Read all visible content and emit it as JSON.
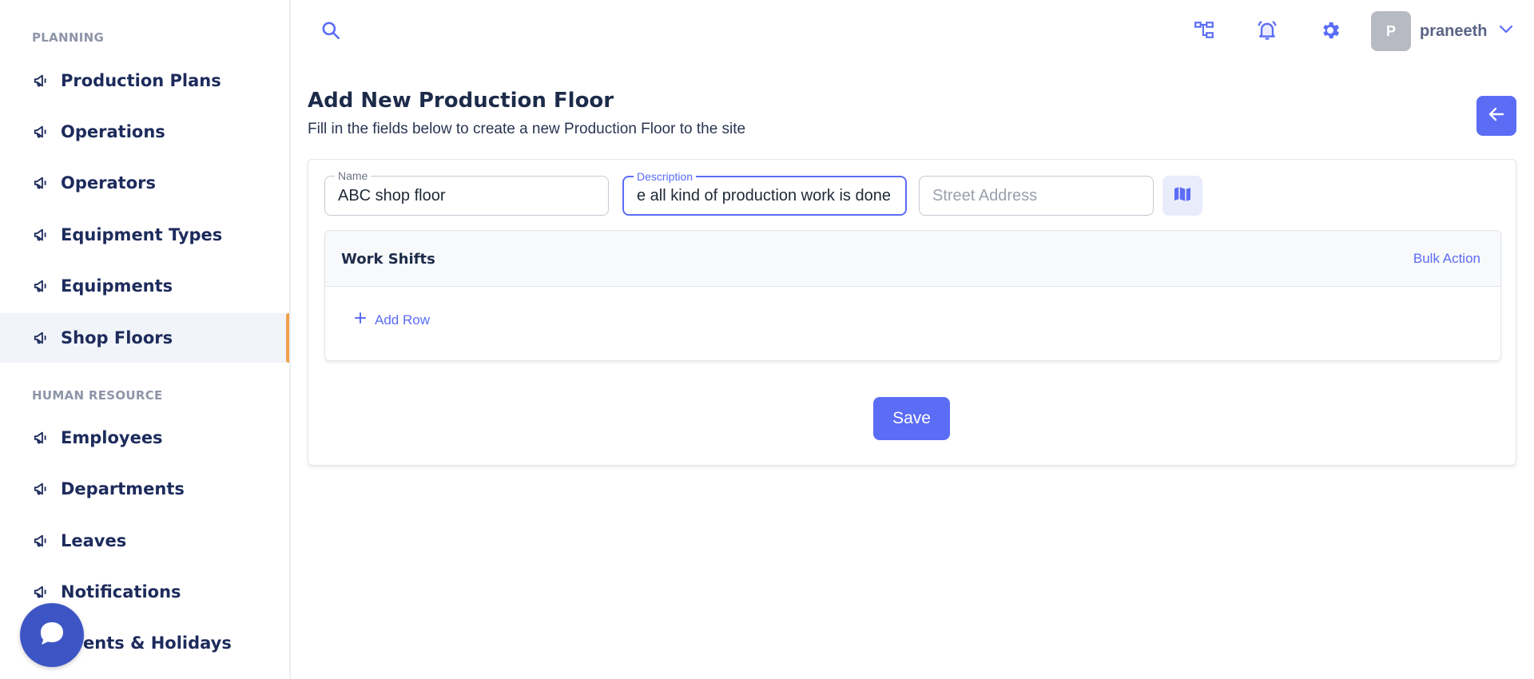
{
  "sidebar": {
    "sections": [
      {
        "label": "PLANNING",
        "items": [
          {
            "label": "Production Plans",
            "icon": "megaphone-icon"
          },
          {
            "label": "Operations",
            "icon": "megaphone-icon"
          },
          {
            "label": "Operators",
            "icon": "megaphone-icon"
          },
          {
            "label": "Equipment Types",
            "icon": "megaphone-icon"
          },
          {
            "label": "Equipments",
            "icon": "megaphone-icon"
          },
          {
            "label": "Shop Floors",
            "icon": "megaphone-icon",
            "active": true
          }
        ]
      },
      {
        "label": "HUMAN RESOURCE",
        "items": [
          {
            "label": "Employees",
            "icon": "megaphone-icon"
          },
          {
            "label": "Departments",
            "icon": "megaphone-icon"
          },
          {
            "label": "Leaves",
            "icon": "megaphone-icon"
          },
          {
            "label": "Notifications",
            "icon": "megaphone-icon"
          },
          {
            "label": "Events & Holidays",
            "icon": "megaphone-icon"
          }
        ]
      }
    ],
    "active_accent_color": "#f0a04b"
  },
  "header": {
    "icons": [
      "search-icon",
      "sitemap-icon",
      "bell-icon",
      "gear-icon",
      "chevron-down-icon"
    ],
    "user": {
      "avatar_initial": "P",
      "name": "praneeth"
    }
  },
  "page": {
    "title": "Add New Production Floor",
    "subtitle": "Fill in the fields below to create a new Production Floor to the site"
  },
  "form": {
    "name": {
      "label": "Name",
      "value": "ABC shop floor"
    },
    "description": {
      "label": "Description",
      "value": "e all kind of production work is done"
    },
    "address": {
      "placeholder": "Street Address",
      "value": ""
    },
    "work_shifts": {
      "title": "Work Shifts",
      "bulk_action": "Bulk Action",
      "add_row": "Add Row"
    },
    "save_label": "Save"
  },
  "colors": {
    "primary": "#5b6cf5",
    "text_dark": "#1d2b5c",
    "chat_bubble": "#3d55c4"
  }
}
